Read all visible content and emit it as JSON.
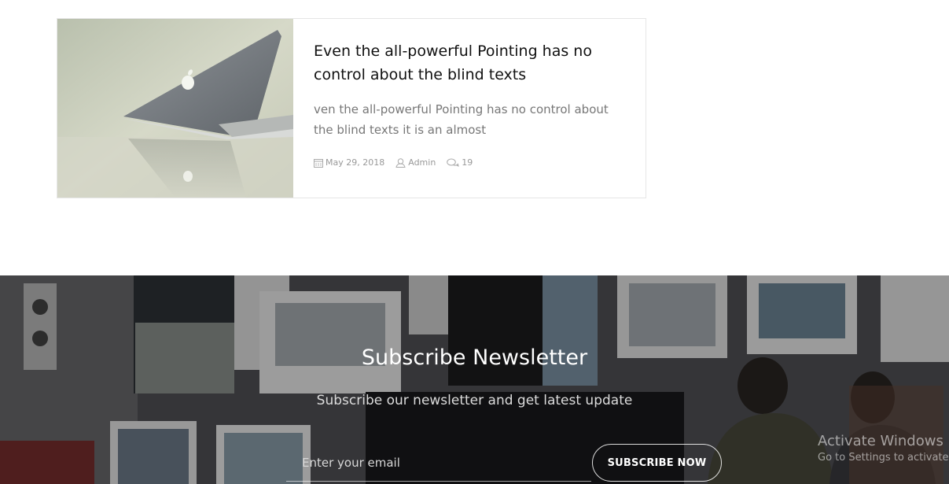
{
  "blog_card": {
    "title": "Even the all-powerful Pointing has no control about the blind texts",
    "excerpt": "ven the all-powerful Pointing has no control about the blind texts it is an almost",
    "meta": {
      "date": "May 29, 2018",
      "author": "Admin",
      "comments": "19"
    }
  },
  "newsletter": {
    "title": "Subscribe Newsletter",
    "subtitle": "Subscribe our newsletter and get latest update",
    "email_placeholder": "Enter your email",
    "button_label": "SUBSCRIBE NOW"
  },
  "windows_watermark": {
    "line1": "Activate Windows",
    "line2": "Go to Settings to activate"
  },
  "icons": {
    "date": "calendar-icon",
    "author": "user-icon",
    "comments": "comments-icon"
  }
}
